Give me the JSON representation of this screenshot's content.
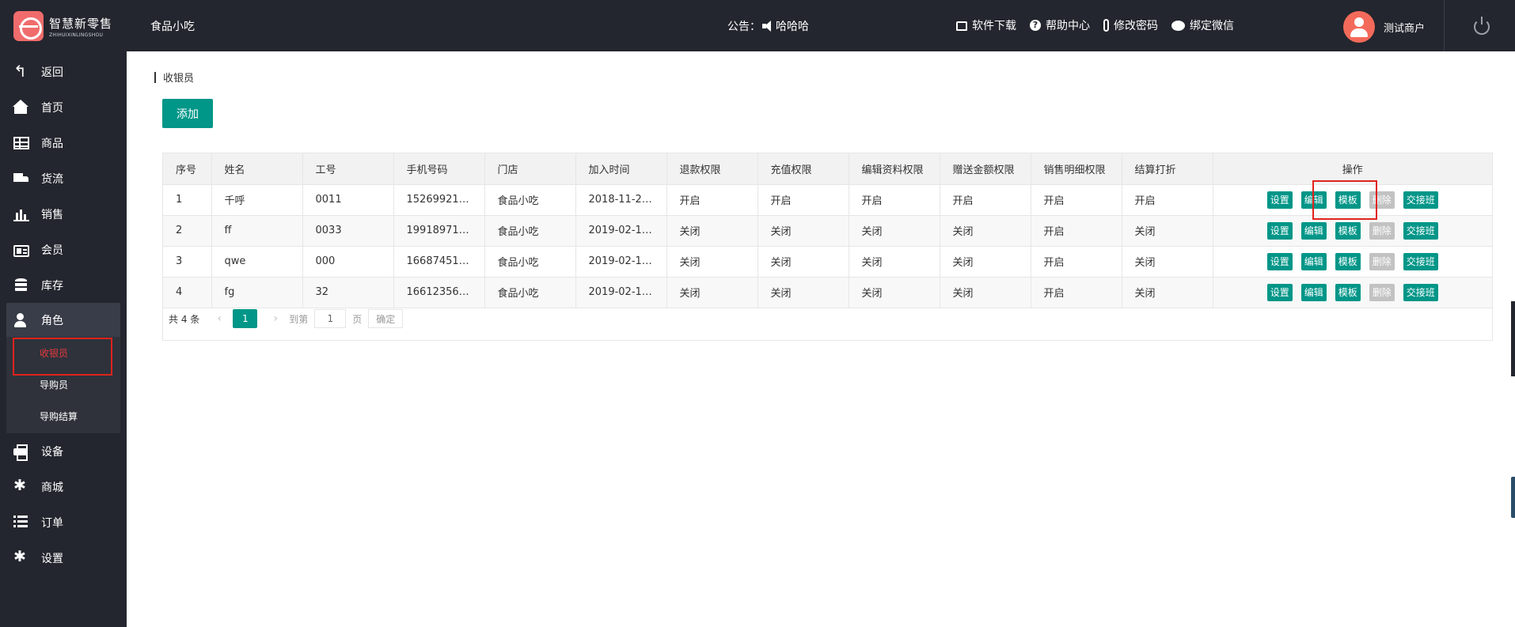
{
  "header": {
    "logo_cn": "智慧新零售",
    "logo_en": "ZHIHUIXINLINGSHOU",
    "store_name": "食品小吃",
    "notice_label": "公告：",
    "notice_text": "哈哈哈",
    "links": [
      {
        "label": "软件下载",
        "icon": "store-icon"
      },
      {
        "label": "帮助中心",
        "icon": "help-icon"
      },
      {
        "label": "修改密码",
        "icon": "thermometer-icon"
      },
      {
        "label": "绑定微信",
        "icon": "wechat-icon"
      }
    ],
    "user_name": "测试商户"
  },
  "sidebar": {
    "items": [
      {
        "label": "返回",
        "icon": "back-icon"
      },
      {
        "label": "首页",
        "icon": "home-icon"
      },
      {
        "label": "商品",
        "icon": "grid-icon"
      },
      {
        "label": "货流",
        "icon": "truck-icon"
      },
      {
        "label": "销售",
        "icon": "bar-chart-icon"
      },
      {
        "label": "会员",
        "icon": "id-card-icon"
      },
      {
        "label": "库存",
        "icon": "database-icon"
      },
      {
        "label": "角色",
        "icon": "user-icon"
      },
      {
        "label": "设备",
        "icon": "printer-icon"
      },
      {
        "label": "商城",
        "icon": "gear-icon"
      },
      {
        "label": "订单",
        "icon": "list-icon"
      },
      {
        "label": "设置",
        "icon": "gear-icon"
      }
    ],
    "submenu": [
      "收银员",
      "导购员",
      "导购结算"
    ]
  },
  "main": {
    "breadcrumb": "收银员",
    "add_label": "添加",
    "columns": [
      "序号",
      "姓名",
      "工号",
      "手机号码",
      "门店",
      "加入时间",
      "退款权限",
      "充值权限",
      "编辑资料权限",
      "赠送金额权限",
      "销售明细权限",
      "结算打折",
      "操作"
    ],
    "rows": [
      [
        "1",
        "千呼",
        "0011",
        "15269921…",
        "食品小吃",
        "2018-11-2…",
        "开启",
        "开启",
        "开启",
        "开启",
        "开启",
        "开启"
      ],
      [
        "2",
        "ff",
        "0033",
        "19918971…",
        "食品小吃",
        "2019-02-1…",
        "关闭",
        "关闭",
        "关闭",
        "关闭",
        "开启",
        "关闭"
      ],
      [
        "3",
        "qwe",
        "000",
        "16687451…",
        "食品小吃",
        "2019-02-1…",
        "关闭",
        "关闭",
        "关闭",
        "关闭",
        "开启",
        "关闭"
      ],
      [
        "4",
        "fg",
        "32",
        "16612356…",
        "食品小吃",
        "2019-02-1…",
        "关闭",
        "关闭",
        "关闭",
        "关闭",
        "开启",
        "关闭"
      ]
    ],
    "actions": [
      "设置",
      "编辑",
      "模板",
      "删除",
      "交接班"
    ],
    "pager": {
      "total": "共 4 条",
      "current": "1",
      "goto_label": "到第",
      "page_value": "1",
      "page_unit": "页",
      "confirm": "确定"
    }
  },
  "colors": {
    "sidebar_bg": "#23262e",
    "accent": "#009688",
    "highlight": "#e0231c"
  }
}
